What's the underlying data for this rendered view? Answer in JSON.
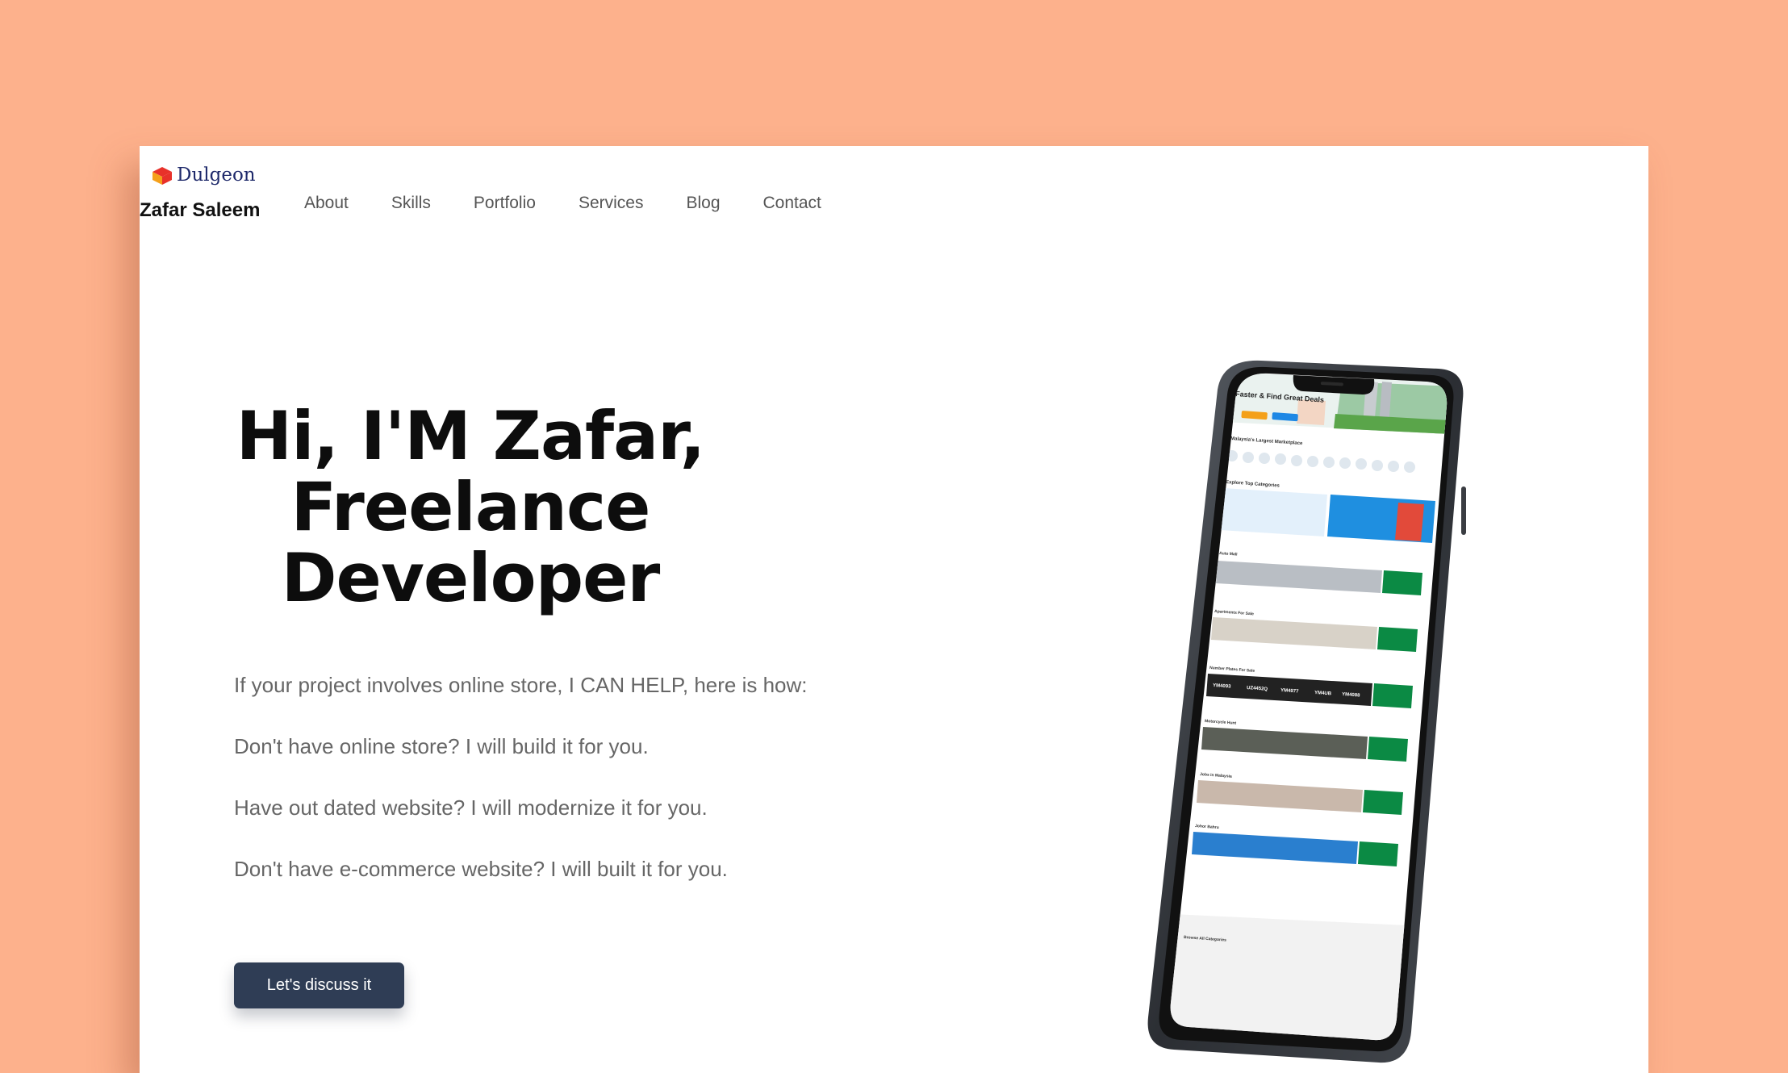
{
  "brand": {
    "logo_text": "Dulgeon",
    "name": "Zafar Saleem"
  },
  "nav": {
    "items": [
      "About",
      "Skills",
      "Portfolio",
      "Services",
      "Blog",
      "Contact"
    ]
  },
  "hero": {
    "title_lines": [
      "Hi, I'M Zafar,",
      "Freelance",
      "Developer"
    ],
    "paragraphs": [
      "If your project involves online store, I CAN HELP, here is how:",
      "Don't have online store? I will build it for you.",
      "Have out dated website? I will modernize it for you.",
      "Don't have e-commerce website? I will built it for you."
    ],
    "cta_label": "Let's discuss it"
  },
  "phone_screen": {
    "hero_heading": "Faster & Find Great Deals",
    "tagline": "Malaysia's Largest Marketplace",
    "top_categories": "Explore Top Categories",
    "sections": [
      "Auto Mall",
      "Apartments For Sale",
      "Number Plates For Sale",
      "Motorcycle Hunt",
      "Jobs in Malaysia",
      "Johor Bahru"
    ],
    "plates": [
      "YM4093",
      "UZ4452Q",
      "YM4977",
      "YM4UB",
      "YM4088"
    ],
    "browse": "Browse All Categories"
  },
  "colors": {
    "background": "#FDB18C",
    "card": "#FFFFFF",
    "cta": "#2F3D55",
    "logo_red": "#E8312A",
    "logo_orange": "#F5A01A"
  }
}
